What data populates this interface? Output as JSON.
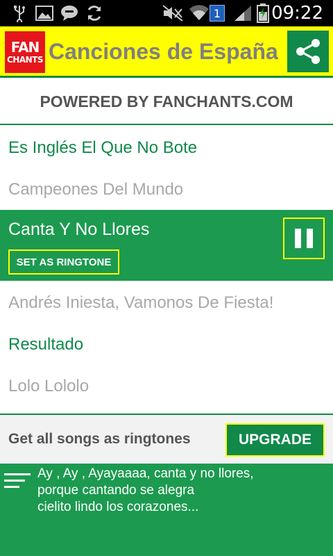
{
  "status_bar": {
    "time": "09:22",
    "sim_badge": "1",
    "icons": [
      "usb-icon",
      "image-icon",
      "chat-icon",
      "sync-icon",
      "mute-icon",
      "wifi-icon",
      "signal-icon",
      "battery-icon"
    ]
  },
  "header": {
    "logo_top": "FAN",
    "logo_bottom": "CHANTS",
    "title": "Canciones de España",
    "share_icon": "share-icon"
  },
  "powered": "POWERED BY FANCHANTS.COM",
  "songs": [
    {
      "title": "Es Inglés El Que No Bote",
      "style": "green"
    },
    {
      "title": "Campeones Del Mundo",
      "style": "grey"
    },
    {
      "title": "Canta Y No Llores",
      "style": "active"
    },
    {
      "title": "Andrés Iniesta, Vamonos De Fiesta!",
      "style": "grey"
    },
    {
      "title": "Resultado",
      "style": "green"
    },
    {
      "title": "Lolo Lololo",
      "style": "grey"
    }
  ],
  "active": {
    "ringtone_label": "SET AS RINGTONE",
    "pause_icon": "pause-icon"
  },
  "upgrade": {
    "text": "Get all songs as ringtones",
    "button": "UPGRADE"
  },
  "lyrics": {
    "lines": [
      "Ay , Ay , Ayayaaaa, canta y no llores,",
      "porque cantando se alegra",
      "cielito lindo los corazones..."
    ]
  },
  "colors": {
    "accent_green": "#10894a",
    "header_yellow": "#ffff00",
    "logo_red": "#e4161b"
  }
}
